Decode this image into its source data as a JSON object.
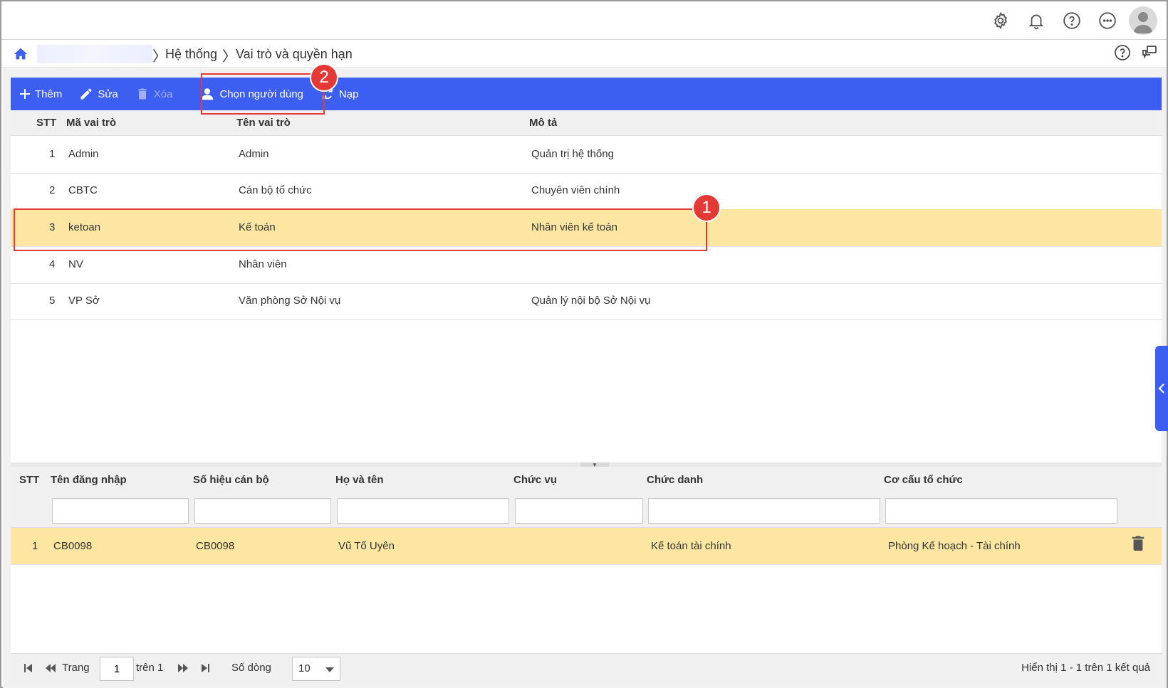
{
  "breadcrumb": {
    "items": [
      "Hệ thống",
      "Vai trò và quyền hạn"
    ]
  },
  "toolbar": {
    "add_label": "Thêm",
    "edit_label": "Sửa",
    "delete_label": "Xóa",
    "select_user_label": "Chọn người dùng",
    "reload_label": "Nạp"
  },
  "roles_grid": {
    "columns": [
      "STT",
      "Mã vai trò",
      "Tên vai trò",
      "Mô tả"
    ],
    "rows": [
      {
        "stt": "1",
        "code": "Admin",
        "name": "Admin",
        "desc": "Quản trị hệ thống"
      },
      {
        "stt": "2",
        "code": "CBTC",
        "name": "Cán bộ tổ chức",
        "desc": "Chuyên viên chính"
      },
      {
        "stt": "3",
        "code": "ketoan",
        "name": "Kế toán",
        "desc": "Nhân viên kế toán"
      },
      {
        "stt": "4",
        "code": "NV",
        "name": "Nhân viên",
        "desc": ""
      },
      {
        "stt": "5",
        "code": "VP Sở",
        "name": "Văn phòng Sở Nội vụ",
        "desc": "Quản lý nội bộ Sở Nội vụ"
      }
    ],
    "selected_index": 2
  },
  "users_grid": {
    "columns": [
      "STT",
      "Tên đăng nhập",
      "Số hiệu cán bộ",
      "Họ và tên",
      "Chức vụ",
      "Chức danh",
      "Cơ cấu tổ chức"
    ],
    "rows": [
      {
        "stt": "1",
        "username": "CB0098",
        "staff_no": "CB0098",
        "full_name": "Vũ Tố Uyên",
        "position": "",
        "title": "Kế toán tài chính",
        "org": "Phòng Kế hoạch - Tài chính"
      }
    ]
  },
  "annotations": {
    "step1": "1",
    "step2": "2"
  },
  "pager": {
    "page_label": "Trang",
    "page_value": "1",
    "of_label": "trên 1",
    "rows_label": "Số dòng",
    "rows_value": "10",
    "summary": "Hiển thị 1 - 1 trên 1 kết quả"
  },
  "colors": {
    "accent": "#3c5ff2",
    "selected_row": "#fde5a2",
    "annotation": "#e53935"
  }
}
